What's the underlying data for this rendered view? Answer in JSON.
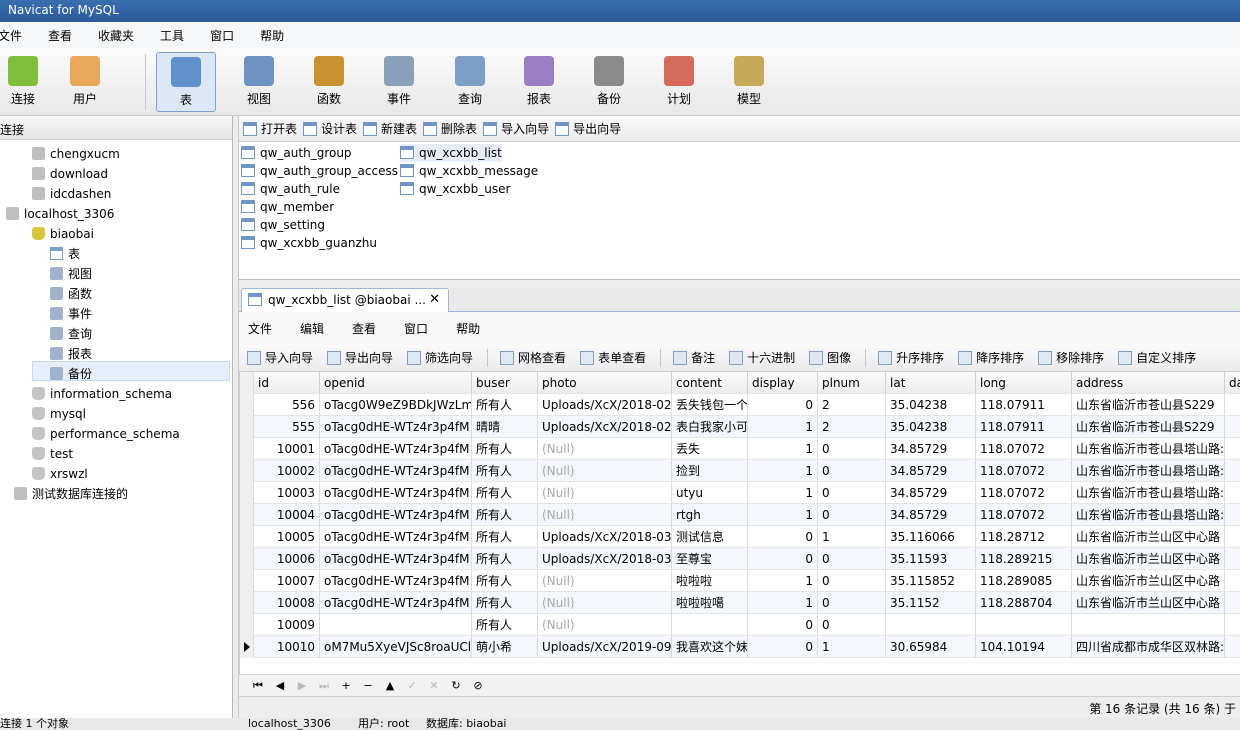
{
  "window": {
    "title": "Navicat for MySQL"
  },
  "menu": [
    "文件",
    "查看",
    "收藏夹",
    "工具",
    "窗口",
    "帮助"
  ],
  "toolbar": [
    {
      "label": "连接",
      "icon": "connection-icon",
      "color": "#7fbf3a"
    },
    {
      "label": "用户",
      "icon": "user-icon",
      "color": "#e8a75a"
    },
    {
      "label": "表",
      "icon": "table-icon",
      "color": "#5f90cc",
      "active": true
    },
    {
      "label": "视图",
      "icon": "view-icon",
      "color": "#6f93c2"
    },
    {
      "label": "函数",
      "icon": "function-icon",
      "color": "#c9922f"
    },
    {
      "label": "事件",
      "icon": "event-icon",
      "color": "#8aa0b8"
    },
    {
      "label": "查询",
      "icon": "query-icon",
      "color": "#7d9ec7"
    },
    {
      "label": "报表",
      "icon": "report-icon",
      "color": "#9a7fc4"
    },
    {
      "label": "备份",
      "icon": "backup-icon",
      "color": "#8a8a8a"
    },
    {
      "label": "计划",
      "icon": "schedule-icon",
      "color": "#d46a5a"
    },
    {
      "label": "模型",
      "icon": "model-icon",
      "color": "#c7a95a"
    }
  ],
  "left_panel": {
    "header": "连接",
    "tree": [
      {
        "label": "chengxucm",
        "icon": "connection-icon",
        "level": 1
      },
      {
        "label": "download",
        "icon": "connection-icon",
        "level": 1
      },
      {
        "label": "idcdashen",
        "icon": "connection-icon",
        "level": 1
      },
      {
        "label": "localhost_3306",
        "icon": "connection-icon",
        "level": 0,
        "expanded": true
      },
      {
        "label": "biaobai",
        "icon": "database-icon",
        "level": 1,
        "expanded": true
      },
      {
        "label": "表",
        "icon": "table-icon",
        "level": 2,
        "selected": true
      },
      {
        "label": "视图",
        "icon": "view-icon",
        "level": 2
      },
      {
        "label": "函数",
        "icon": "function-icon",
        "level": 2
      },
      {
        "label": "事件",
        "icon": "event-icon",
        "level": 2
      },
      {
        "label": "查询",
        "icon": "query-icon",
        "level": 2
      },
      {
        "label": "报表",
        "icon": "report-icon",
        "level": 2
      },
      {
        "label": "备份",
        "icon": "backup-icon",
        "level": 2
      },
      {
        "label": "information_schema",
        "icon": "database-icon",
        "level": 1
      },
      {
        "label": "mysql",
        "icon": "database-icon",
        "level": 1
      },
      {
        "label": "performance_schema",
        "icon": "database-icon",
        "level": 1
      },
      {
        "label": "test",
        "icon": "database-icon",
        "level": 1
      },
      {
        "label": "xrswzl",
        "icon": "database-icon",
        "level": 1
      },
      {
        "label": "测试数据库连接的",
        "icon": "connection-icon",
        "level": 0
      }
    ]
  },
  "object_toolbar": [
    "打开表",
    "设计表",
    "新建表",
    "删除表",
    "导入向导",
    "导出向导"
  ],
  "tables_col1": [
    "qw_auth_group",
    "qw_auth_group_access",
    "qw_auth_rule",
    "qw_member",
    "qw_setting",
    "qw_xcxbb_guanzhu"
  ],
  "tables_col2": [
    "qw_xcxbb_list",
    "qw_xcxbb_message",
    "qw_xcxbb_user"
  ],
  "doc_tab": {
    "title": "qw_xcxbb_list @biaobai ...",
    "close": "✕"
  },
  "inner_menu": [
    "文件",
    "编辑",
    "查看",
    "窗口",
    "帮助"
  ],
  "inner_toolbar": [
    "导入向导",
    "导出向导",
    "筛选向导",
    "网格查看",
    "表单查看",
    "备注",
    "十六进制",
    "图像",
    "升序排序",
    "降序排序",
    "移除排序",
    "自定义排序"
  ],
  "grid": {
    "columns": [
      "id",
      "openid",
      "buser",
      "photo",
      "content",
      "display",
      "plnum",
      "lat",
      "long",
      "address",
      "da"
    ],
    "rows": [
      [
        "556",
        "oTacg0W9eZ9BDkJWzLm",
        "所有人",
        "Uploads/XcX/2018-02-",
        "丢失钱包一个",
        "0",
        "2",
        "35.04238",
        "118.07911",
        "山东省临沂市苍山县S229",
        ""
      ],
      [
        "555",
        "oTacg0dHE-WTz4r3p4fM",
        "晴晴",
        "Uploads/XcX/2018-02-",
        "表白我家小可",
        "1",
        "2",
        "35.04238",
        "118.07911",
        "山东省临沂市苍山县S229",
        ""
      ],
      [
        "10001",
        "oTacg0dHE-WTz4r3p4fM",
        "所有人",
        "(Null)",
        "丢失",
        "1",
        "0",
        "34.85729",
        "118.07072",
        "山东省临沂市苍山县塔山路:",
        ""
      ],
      [
        "10002",
        "oTacg0dHE-WTz4r3p4fM",
        "所有人",
        "(Null)",
        "捡到",
        "1",
        "0",
        "34.85729",
        "118.07072",
        "山东省临沂市苍山县塔山路:",
        ""
      ],
      [
        "10003",
        "oTacg0dHE-WTz4r3p4fM",
        "所有人",
        "(Null)",
        "utyu",
        "1",
        "0",
        "34.85729",
        "118.07072",
        "山东省临沂市苍山县塔山路:",
        ""
      ],
      [
        "10004",
        "oTacg0dHE-WTz4r3p4fM",
        "所有人",
        "(Null)",
        "rtgh",
        "1",
        "0",
        "34.85729",
        "118.07072",
        "山东省临沂市苍山县塔山路:",
        ""
      ],
      [
        "10005",
        "oTacg0dHE-WTz4r3p4fM",
        "所有人",
        "Uploads/XcX/2018-03-",
        "测试信息",
        "0",
        "1",
        "35.116066",
        "118.28712",
        "山东省临沂市兰山区中心路",
        ""
      ],
      [
        "10006",
        "oTacg0dHE-WTz4r3p4fM",
        "所有人",
        "Uploads/XcX/2018-03-",
        "至尊宝",
        "0",
        "0",
        "35.11593",
        "118.289215",
        "山东省临沂市兰山区中心路",
        ""
      ],
      [
        "10007",
        "oTacg0dHE-WTz4r3p4fM",
        "所有人",
        "(Null)",
        "啦啦啦",
        "1",
        "0",
        "35.115852",
        "118.289085",
        "山东省临沂市兰山区中心路",
        ""
      ],
      [
        "10008",
        "oTacg0dHE-WTz4r3p4fM",
        "所有人",
        "(Null)",
        "啦啦啦噶",
        "1",
        "0",
        "35.1152",
        "118.288704",
        "山东省临沂市兰山区中心路",
        ""
      ],
      [
        "10009",
        "",
        "所有人",
        "(Null)",
        "",
        "0",
        "0",
        "",
        "",
        "",
        ""
      ],
      [
        "10010",
        "oM7Mu5XyeVJSc8roaUCl",
        "萌小希",
        "Uploads/XcX/2019-09-",
        "我喜欢这个妹",
        "0",
        "1",
        "30.65984",
        "104.10194",
        "四川省成都市成华区双林路:",
        ""
      ]
    ],
    "current_row": 11
  },
  "nav_buttons": [
    "⏮",
    "◀",
    "▶",
    "⏭",
    "+",
    "−",
    "▲",
    "✓",
    "✕",
    "↻",
    "⊘"
  ],
  "record_status": "第 16 条记录 (共 16 条) 于",
  "status_bar": {
    "left": "连接 1 个对象",
    "conn": "localhost_3306",
    "user": "用户: root",
    "db": "数据库: biaobai"
  }
}
